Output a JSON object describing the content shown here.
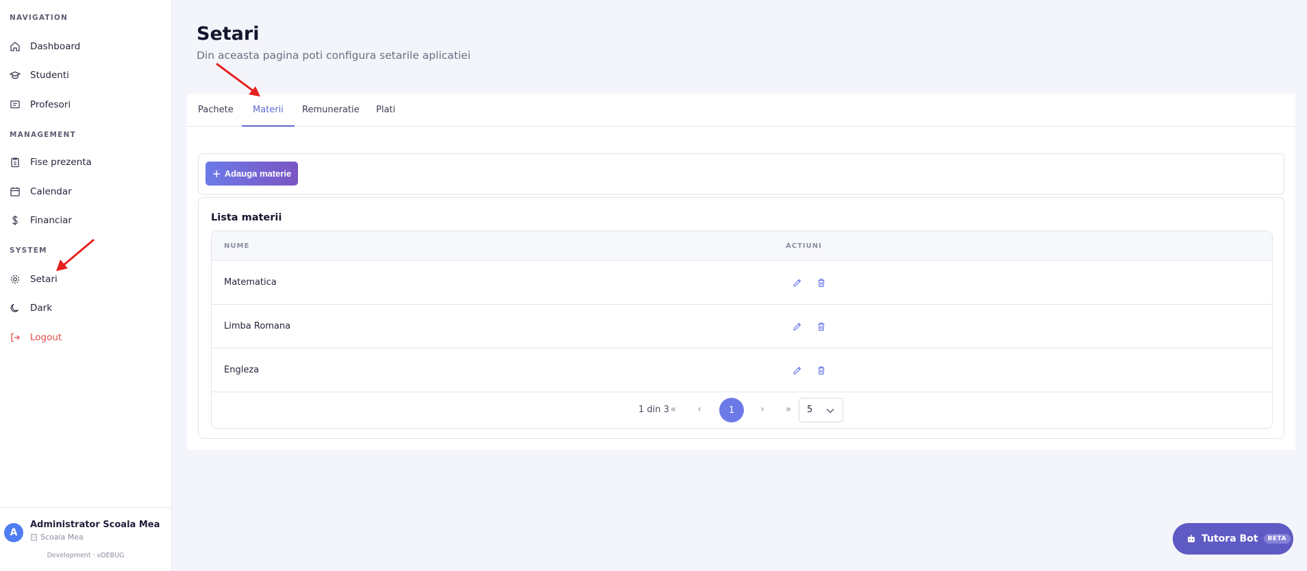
{
  "sidebar": {
    "sections": {
      "navigation": "NAVIGATION",
      "management": "MANAGEMENT",
      "system": "SYSTEM"
    },
    "items": {
      "dashboard": "Dashboard",
      "studenti": "Studenti",
      "profesori": "Profesori",
      "fise": "Fise prezenta",
      "calendar": "Calendar",
      "financiar": "Financiar",
      "setari": "Setari",
      "dark": "Dark",
      "logout": "Logout"
    },
    "user": {
      "initial": "A",
      "name": "Administrator Scoala Mea",
      "org": "Scoala Mea",
      "env": "Development · vDEBUG"
    }
  },
  "header": {
    "title": "Setari",
    "subtitle": "Din aceasta pagina poti configura setarile aplicatiei"
  },
  "tabs": {
    "pachete": "Pachete",
    "materii": "Materii",
    "remuneratie": "Remuneratie",
    "plati": "Plati"
  },
  "toolbar": {
    "add_label": "Adauga materie"
  },
  "list": {
    "title": "Lista materii",
    "columns": {
      "name": "NUME",
      "actions": "ACTIUNI"
    },
    "rows": [
      {
        "name": "Matematica"
      },
      {
        "name": "Limba Romana"
      },
      {
        "name": "Engleza"
      }
    ]
  },
  "pager": {
    "info": "1 din 3",
    "first": "«",
    "prev": "‹",
    "current": "1",
    "next": "›",
    "last": "»",
    "page_size": "5"
  },
  "bot": {
    "label": "Tutora Bot",
    "badge": "BETA"
  },
  "colors": {
    "accent": "#6c7ae8",
    "logout": "#e2504a",
    "bot": "#5f5bc4"
  }
}
